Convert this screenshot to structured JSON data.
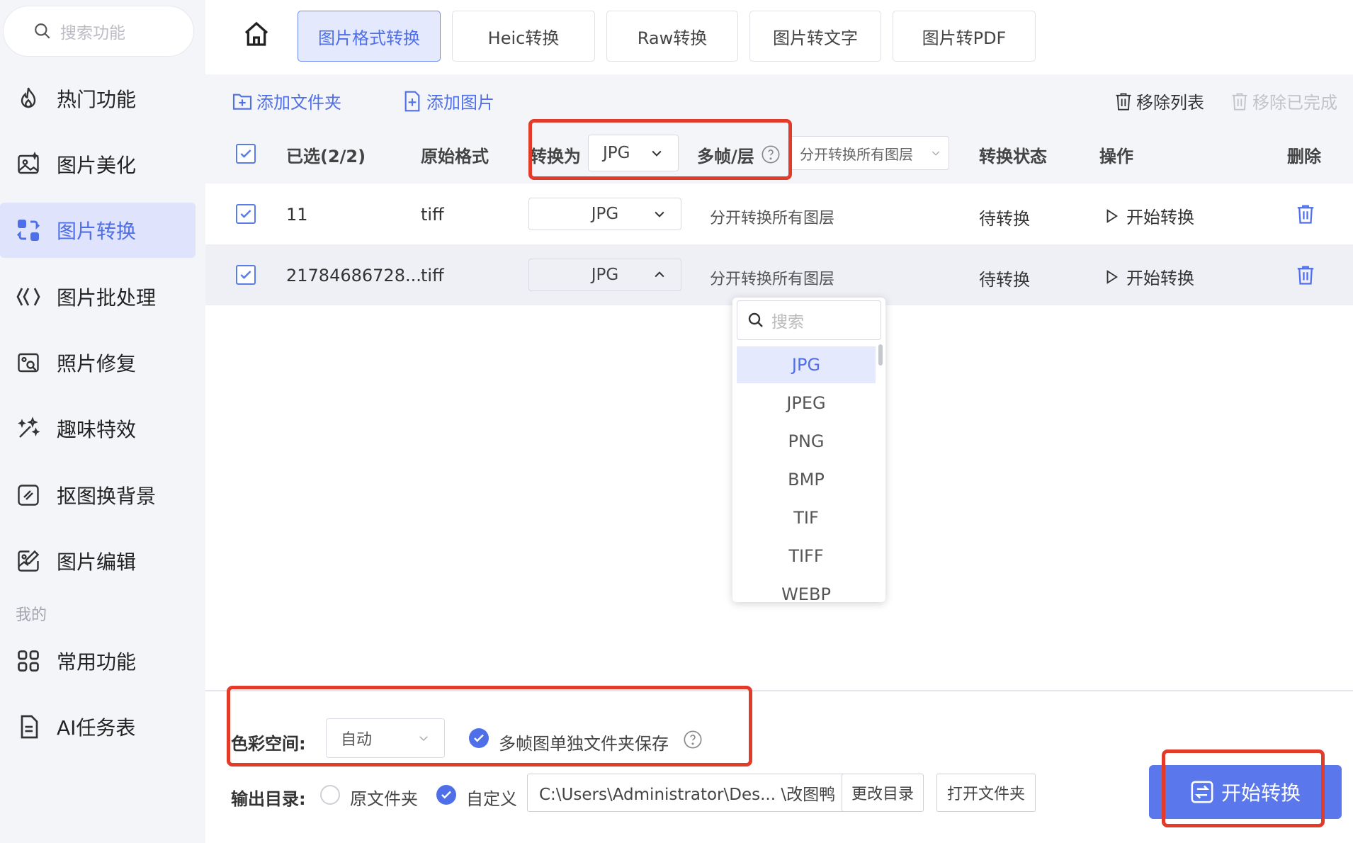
{
  "sidebar": {
    "search_placeholder": "搜索功能",
    "items": [
      {
        "label": "热门功能",
        "icon": "flame-icon"
      },
      {
        "label": "图片美化",
        "icon": "image-sparkle-icon"
      },
      {
        "label": "图片转换",
        "icon": "convert-icon",
        "active": true
      },
      {
        "label": "图片批处理",
        "icon": "batch-icon"
      },
      {
        "label": "照片修复",
        "icon": "photo-repair-icon"
      },
      {
        "label": "趣味特效",
        "icon": "magic-wand-icon"
      },
      {
        "label": "抠图换背景",
        "icon": "cutout-icon"
      },
      {
        "label": "图片编辑",
        "icon": "image-edit-icon"
      }
    ],
    "group_label": "我的",
    "my_items": [
      {
        "label": "常用功能",
        "icon": "grid-icon"
      },
      {
        "label": "AI任务表",
        "icon": "task-list-icon"
      }
    ]
  },
  "tabs": [
    {
      "label": "图片格式转换",
      "active": true
    },
    {
      "label": "Heic转换"
    },
    {
      "label": "Raw转换"
    },
    {
      "label": "图片转文字"
    },
    {
      "label": "图片转PDF"
    }
  ],
  "toolbar": {
    "add_folder": "添加文件夹",
    "add_image": "添加图片",
    "remove_list": "移除列表",
    "remove_done": "移除已完成"
  },
  "table": {
    "selected": "已选(2/2)",
    "col_format": "原始格式",
    "col_convert_to": "转换为",
    "convert_to_value": "JPG",
    "col_multiframe": "多帧/层",
    "multiframe_value": "分开转换所有图层",
    "col_status": "转换状态",
    "col_action": "操作",
    "col_delete": "删除",
    "rows": [
      {
        "name": "11",
        "format": "tiff",
        "target": "JPG",
        "layers": "分开转换所有图层",
        "status": "待转换",
        "action": "开始转换"
      },
      {
        "name": "21784686728...",
        "format": "tiff",
        "target": "JPG",
        "layers": "分开转换所有图层",
        "status": "待转换",
        "action": "开始转换"
      }
    ]
  },
  "dropdown": {
    "search_placeholder": "搜索",
    "options": [
      "JPG",
      "JPEG",
      "PNG",
      "BMP",
      "TIF",
      "TIFF",
      "WEBP"
    ],
    "selected": "JPG"
  },
  "bottom": {
    "color_space_label": "色彩空间:",
    "color_space_value": "自动",
    "multiframe_folder": "多帧图单独文件夹保存",
    "output_label": "输出目录:",
    "radio_original": "原文件夹",
    "radio_custom": "自定义",
    "path": "C:\\Users\\Administrator\\Des... \\改图鸭",
    "change_dir": "更改目录",
    "open_folder": "打开文件夹",
    "start": "开始转换"
  },
  "colors": {
    "accent": "#4f6fe8",
    "highlight": "#e23b2a"
  }
}
